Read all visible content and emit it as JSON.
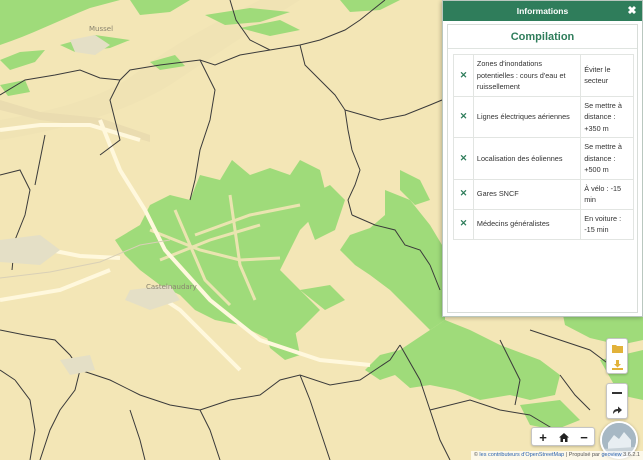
{
  "map": {
    "place_labels": [
      "Mussel",
      "Castelnaudary"
    ],
    "colors": {
      "background": "#f3e6b6",
      "forest": "#9fdb7a",
      "road": "#fff8dd",
      "boundary": "#3a3a3a"
    }
  },
  "panel": {
    "header_title": "Informations",
    "close_icon": "close-icon",
    "title": "Compilation",
    "rows": [
      {
        "label": "Zones d'inondations potentielles : cours d'eau et ruissellement",
        "action": "Éviter le secteur"
      },
      {
        "label": "Lignes électriques aériennes",
        "action": "Se mettre à distance : +350 m"
      },
      {
        "label": "Localisation des éoliennes",
        "action": "Se mettre à distance : +500 m"
      },
      {
        "label": "Gares SNCF",
        "action": "À vélo : -15 min"
      },
      {
        "label": "Médecins généralistes",
        "action": "En voiture : -15 min"
      }
    ],
    "remove_symbol": "✕",
    "accent": "#2f7d5b"
  },
  "controls": {
    "layers_icon": "folder-icon",
    "download_icon": "download-icon",
    "undo_icon": "undo-icon",
    "redo_icon": "redo-icon",
    "zoom_in": "+",
    "zoom_out": "−",
    "home_icon": "home-icon"
  },
  "attribution": {
    "prefix": "© ",
    "osm": "les contributeurs d'OpenStreetMap",
    "sep": " | Propulsé par ",
    "powered": "geoview",
    "version": " 3.6.2.1"
  }
}
